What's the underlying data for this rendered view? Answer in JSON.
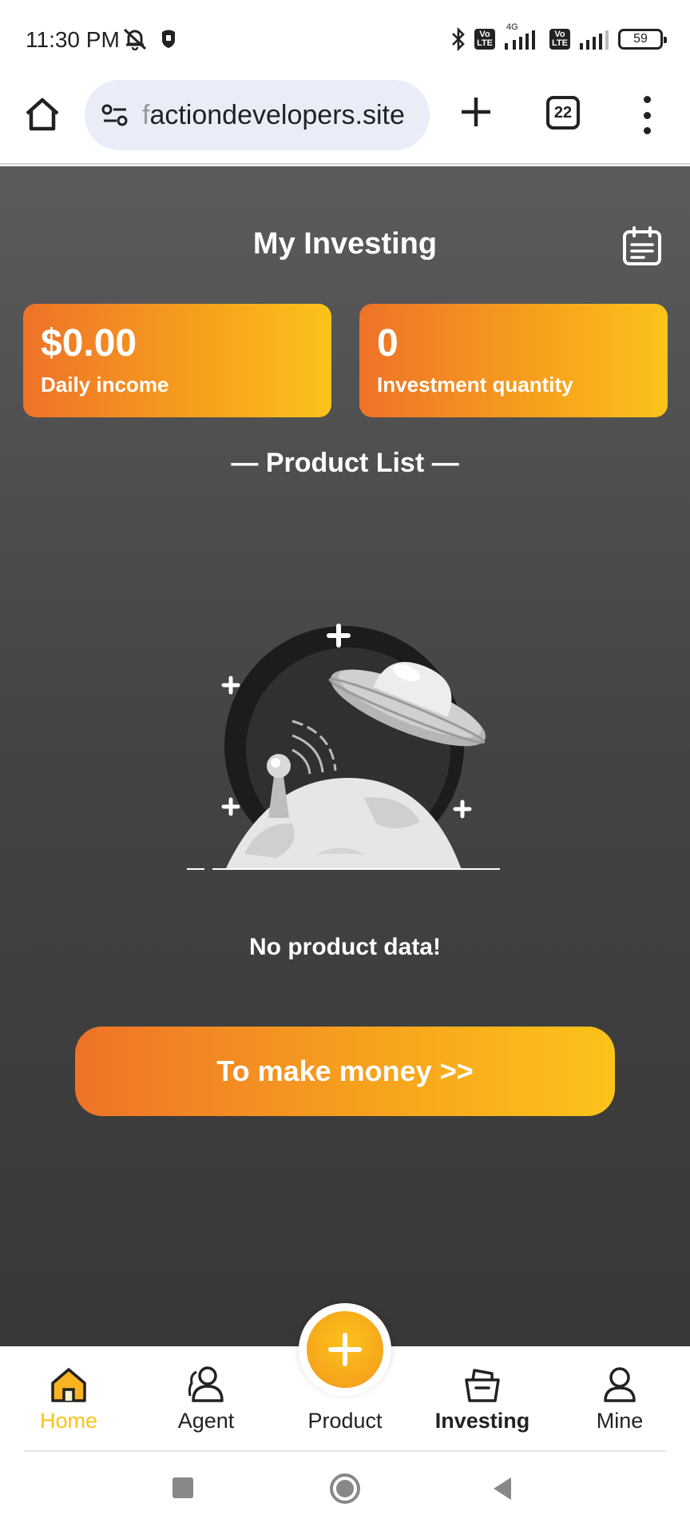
{
  "status_bar": {
    "time": "11:30 PM",
    "network_label": "4G",
    "volte_label": "Vo LTE",
    "battery": "59"
  },
  "browser": {
    "url_faded": "f",
    "url_rest": "actiondevelopers.site",
    "tab_count": "22"
  },
  "page": {
    "title": "My Investing",
    "stats": [
      {
        "value": "$0.00",
        "label": "Daily income"
      },
      {
        "value": "0",
        "label": "Investment quantity"
      }
    ],
    "section_title": "— Product List —",
    "empty_message": "No product data!",
    "cta_label": "To make money >>"
  },
  "bottom_nav": {
    "items": [
      {
        "label": "Home",
        "icon": "home-icon"
      },
      {
        "label": "Agent",
        "icon": "agent-icon"
      },
      {
        "label": "Product",
        "icon": "plus-icon"
      },
      {
        "label": "Investing",
        "icon": "basket-icon"
      },
      {
        "label": "Mine",
        "icon": "user-icon"
      }
    ],
    "active": "Home",
    "current": "Investing"
  },
  "colors": {
    "accent_start": "#ee7328",
    "accent_end": "#fbc31a",
    "background_top": "#5b5b5b",
    "background_bottom": "#383838"
  }
}
